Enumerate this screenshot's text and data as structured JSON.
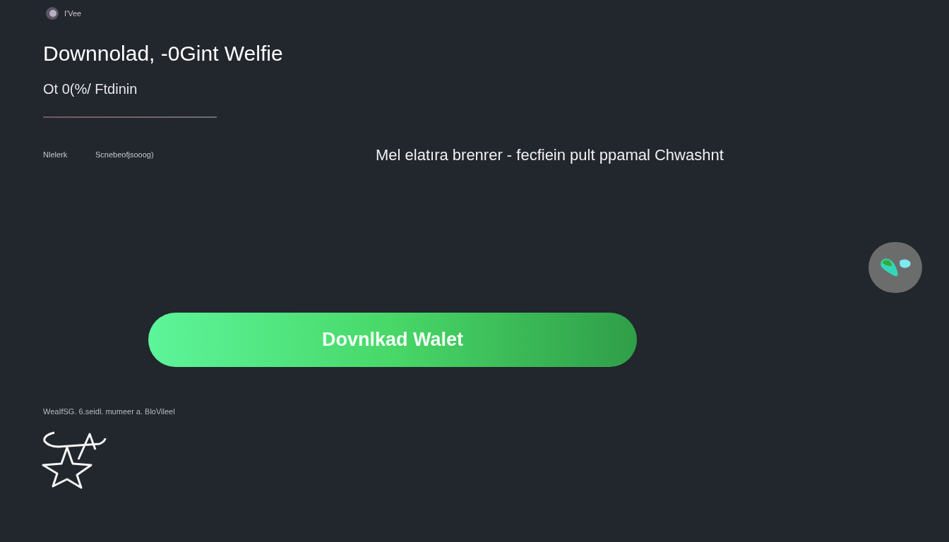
{
  "brand": {
    "name": "I'Vee"
  },
  "title": "Downnolad, -0Gint  Welfie",
  "subtitle": "Ot 0(%/ Ftdinin",
  "meta": [
    "Nlelerk",
    "Scnebeofjsooog)"
  ],
  "tagline": "Mel elatıra brenrer - fecfiein  pult  ppamal Chwashnt",
  "download_button": {
    "label": "Dovnlkad Walet"
  },
  "footer_note": "WeaIfSG. 6.seidl.  mumeer a. BloVileel"
}
